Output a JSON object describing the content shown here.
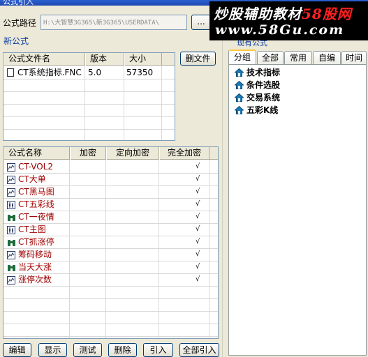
{
  "window": {
    "title": "公式引入"
  },
  "watermark": {
    "line1_prefix": "炒股辅助教材",
    "line1_suffix": "58股网",
    "line2": "www.58Gu.com"
  },
  "path": {
    "label": "公式路径",
    "value": "H:\\大智慧3G365\\新3G365\\USERDATA\\",
    "browse_label": "..."
  },
  "new_formula_label": "新公式",
  "files": {
    "headers": [
      "公式文件名",
      "版本",
      "大小"
    ],
    "rows": [
      {
        "name": "CT系统指标.FNC",
        "version": "5.0",
        "size": "57350"
      }
    ],
    "delete_button": "删文件"
  },
  "formulas": {
    "headers": [
      "公式名称",
      "加密",
      "定向加密",
      "完全加密"
    ],
    "rows": [
      {
        "name": "CT-VOL2",
        "icon": "indicator-icon",
        "full": "√"
      },
      {
        "name": "CT大单",
        "icon": "indicator-icon",
        "full": "√"
      },
      {
        "name": "CT黑马图",
        "icon": "indicator-icon",
        "full": "√"
      },
      {
        "name": "CT五彩线",
        "icon": "kline-icon",
        "full": "√"
      },
      {
        "name": "CT一夜情",
        "icon": "binoculars-icon",
        "full": "√"
      },
      {
        "name": "CT主图",
        "icon": "kline-icon",
        "full": "√"
      },
      {
        "name": "CT抓涨停",
        "icon": "binoculars-icon",
        "full": "√"
      },
      {
        "name": "筹码移动",
        "icon": "indicator-icon",
        "full": "√"
      },
      {
        "name": "当天大涨",
        "icon": "binoculars-icon",
        "full": "√"
      },
      {
        "name": "涨停次数",
        "icon": "indicator-icon",
        "full": "√"
      }
    ]
  },
  "buttons": {
    "edit": "编辑",
    "show": "显示",
    "test": "测试",
    "delete": "删除",
    "import": "引入",
    "import_all": "全部引入"
  },
  "existing": {
    "label": "现有公式",
    "tabs": [
      "分组",
      "全部",
      "常用",
      "自编",
      "时间"
    ],
    "active_tab": 0,
    "tree": [
      "技术指标",
      "条件选股",
      "交易系统",
      "五彩K线"
    ]
  },
  "colors": {
    "formula_text": "#a00000",
    "selection": "#316ac5",
    "background": "#ece9d8"
  }
}
